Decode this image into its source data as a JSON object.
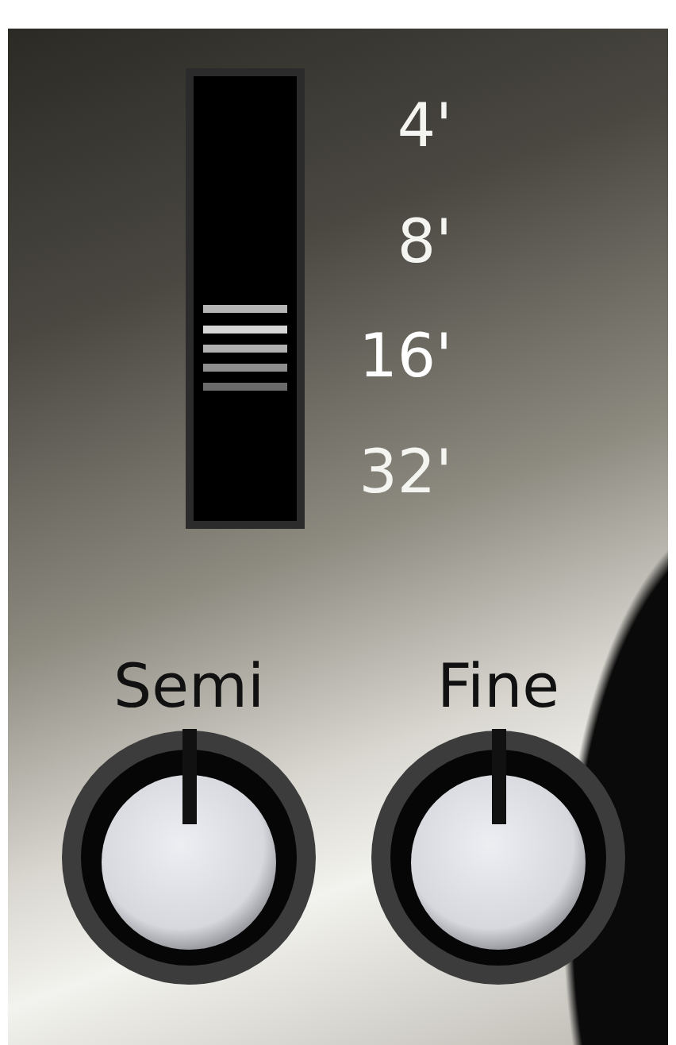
{
  "footage_switch": {
    "options": [
      {
        "label": "4'",
        "selected": false
      },
      {
        "label": "8'",
        "selected": false
      },
      {
        "label": "16'",
        "selected": true
      },
      {
        "label": "32'",
        "selected": false
      }
    ]
  },
  "knobs": [
    {
      "label": "Semi",
      "level": 0.5
    },
    {
      "label": "Fine",
      "level": 0.5
    }
  ]
}
